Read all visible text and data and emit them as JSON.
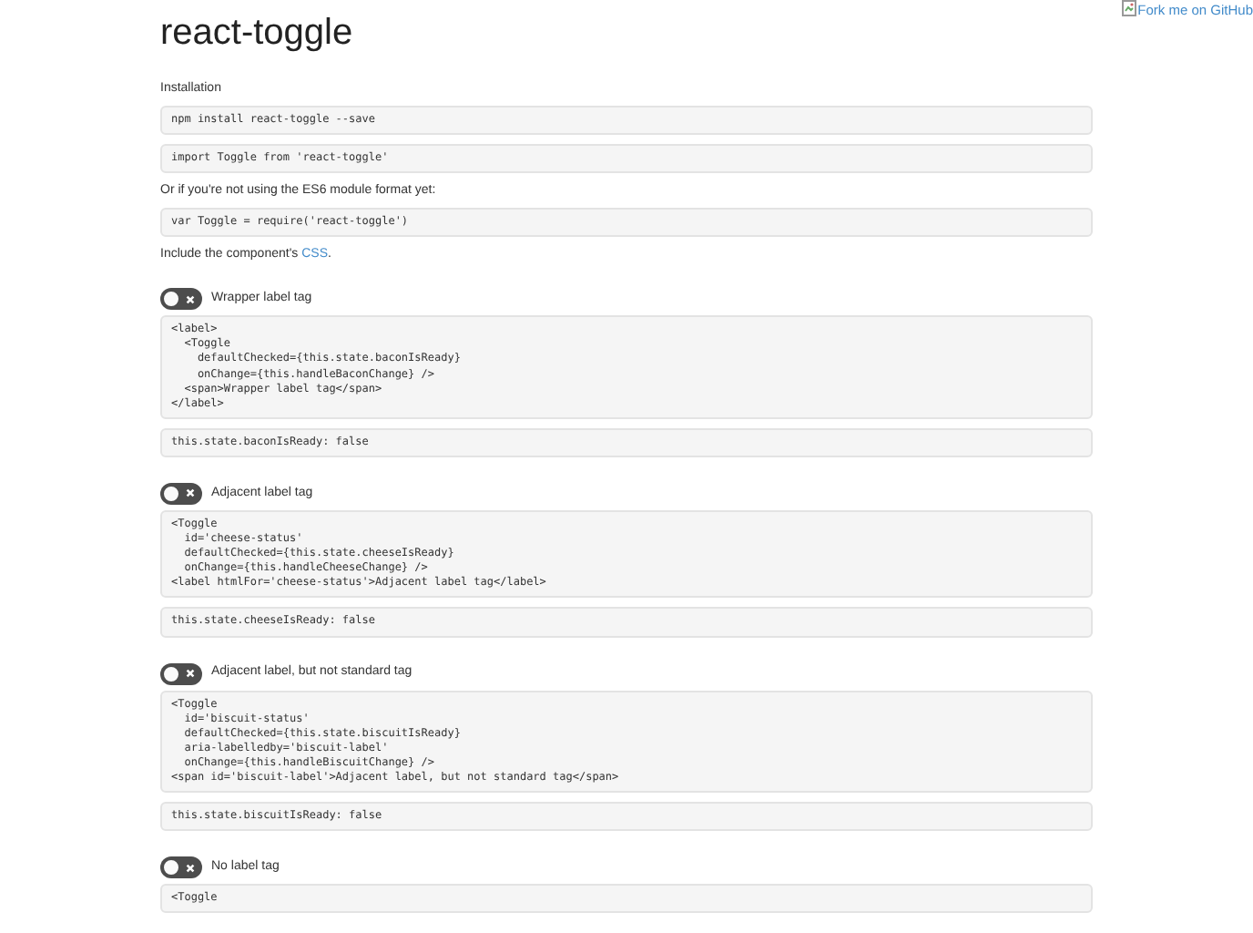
{
  "header": {
    "title": "react-toggle",
    "fork_link": "Fork me on GitHub"
  },
  "intro": [
    {
      "kind": "text",
      "text": "Installation"
    },
    {
      "kind": "code",
      "lines": [
        "npm install react-toggle --save"
      ]
    },
    {
      "kind": "code",
      "lines": [
        "import Toggle from 'react-toggle'"
      ]
    },
    {
      "kind": "text",
      "text": "Or if you're not using the ES6 module format yet:"
    },
    {
      "kind": "code",
      "lines": [
        "var Toggle = require('react-toggle')"
      ]
    },
    {
      "kind": "text",
      "text": "Include the component's ",
      "link": "CSS",
      "after": "."
    }
  ],
  "examples": [
    {
      "label": "Wrapper label tag",
      "checked": false,
      "code": [
        "<label>",
        "  <Toggle",
        "    defaultChecked={this.state.baconIsReady}",
        "    onChange={this.handleBaconChange} />",
        "  <span>Wrapper label tag</span>",
        "</label>"
      ],
      "state": "this.state.baconIsReady: false"
    },
    {
      "label": "Adjacent label tag",
      "checked": false,
      "code": [
        "<Toggle",
        "  id='cheese-status'",
        "  defaultChecked={this.state.cheeseIsReady}",
        "  onChange={this.handleCheeseChange} />",
        "<label htmlFor='cheese-status'>Adjacent label tag</label>"
      ],
      "state": "this.state.cheeseIsReady: false"
    },
    {
      "label": "Adjacent label, but not standard tag",
      "checked": false,
      "code": [
        "<Toggle",
        "  id='biscuit-status'",
        "  defaultChecked={this.state.biscuitIsReady}",
        "  aria-labelledby='biscuit-label'",
        "  onChange={this.handleBiscuitChange} />",
        "<span id='biscuit-label'>Adjacent label, but not standard tag</span>"
      ],
      "state": "this.state.biscuitIsReady: false"
    },
    {
      "label": "No label tag",
      "checked": false,
      "code": [
        "<Toggle"
      ]
    }
  ]
}
